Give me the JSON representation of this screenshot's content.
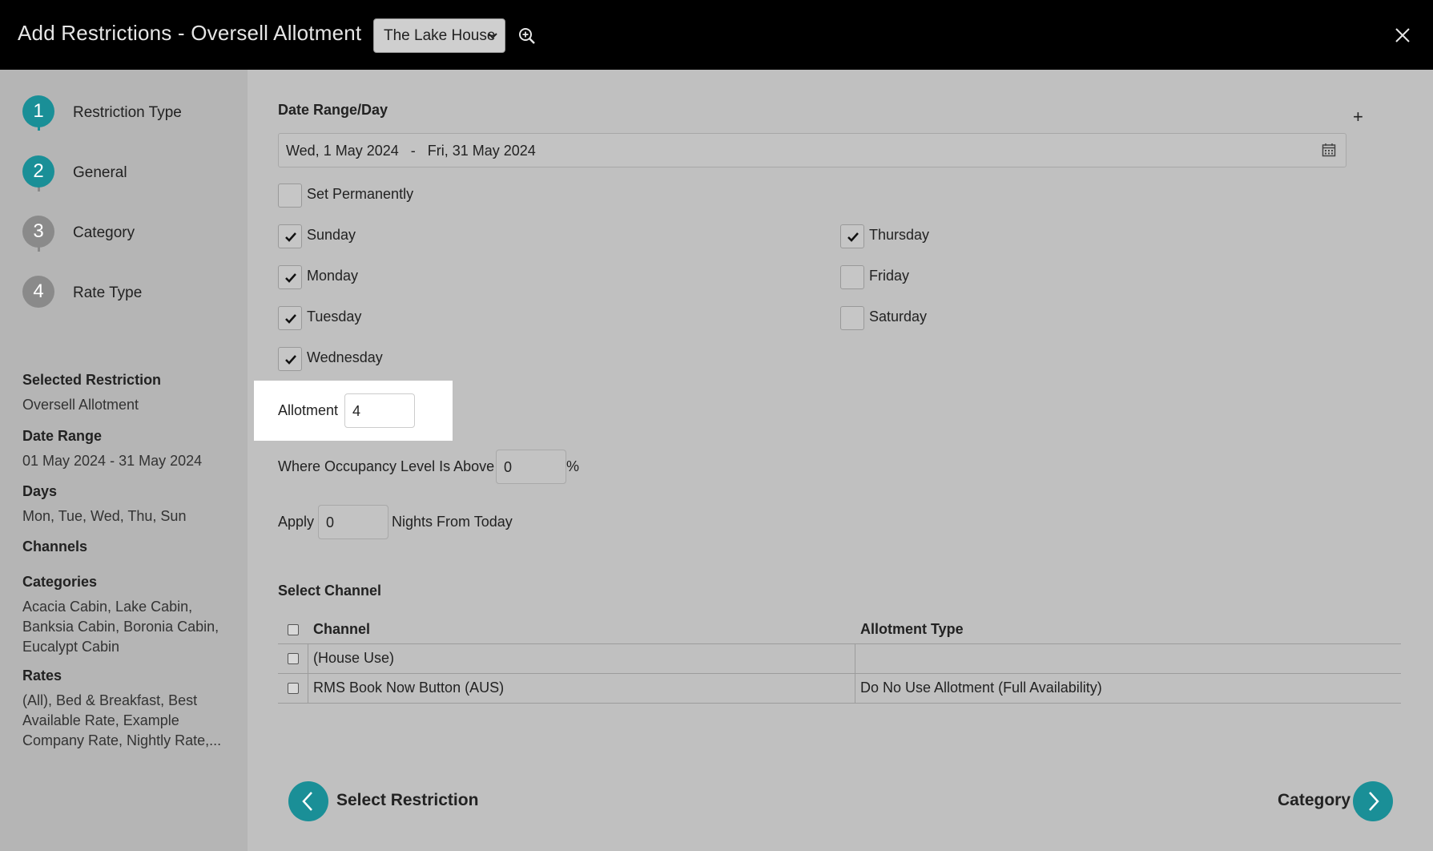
{
  "header": {
    "title": "Add Restrictions - Oversell Allotment",
    "property": "The Lake House"
  },
  "steps": [
    {
      "num": "1",
      "label": "Restriction Type",
      "state": "complete"
    },
    {
      "num": "2",
      "label": "General",
      "state": "current"
    },
    {
      "num": "3",
      "label": "Category",
      "state": "pending"
    },
    {
      "num": "4",
      "label": "Rate Type",
      "state": "pending"
    }
  ],
  "summary": {
    "selected_restriction_label": "Selected Restriction",
    "selected_restriction_value": "Oversell Allotment",
    "date_range_label": "Date Range",
    "date_range_value": "01 May 2024 - 31 May 2024",
    "days_label": "Days",
    "days_value": "Mon, Tue, Wed, Thu, Sun",
    "channels_label": "Channels",
    "categories_label": "Categories",
    "categories_value": "Acacia Cabin, Lake Cabin, Banksia Cabin, Boronia Cabin, Eucalypt Cabin",
    "rates_label": "Rates",
    "rates_value": "(All), Bed & Breakfast, Best Available Rate, Example Company Rate, Nightly Rate,..."
  },
  "form": {
    "date_section_title": "Date Range/Day",
    "date_range": "Wed, 1 May 2024   -   Fri, 31 May 2024",
    "set_permanently": {
      "label": "Set Permanently",
      "checked": false
    },
    "days": {
      "sunday": {
        "label": "Sunday",
        "checked": true
      },
      "monday": {
        "label": "Monday",
        "checked": true
      },
      "tuesday": {
        "label": "Tuesday",
        "checked": true
      },
      "wednesday": {
        "label": "Wednesday",
        "checked": true
      },
      "thursday": {
        "label": "Thursday",
        "checked": true
      },
      "friday": {
        "label": "Friday",
        "checked": false
      },
      "saturday": {
        "label": "Saturday",
        "checked": false
      }
    },
    "allotment_label": "Allotment",
    "allotment_value": "4",
    "occupancy_label": "Where Occupancy Level Is Above",
    "occupancy_value": "0",
    "occupancy_unit": "%",
    "apply_label": "Apply",
    "apply_value": "0",
    "apply_suffix": "Nights From Today"
  },
  "channels": {
    "title": "Select Channel",
    "col_channel": "Channel",
    "col_allotment_type": "Allotment Type",
    "rows": [
      {
        "channel": "(House Use)",
        "allotment_type": ""
      },
      {
        "channel": "RMS Book Now Button (AUS)",
        "allotment_type": "Do No Use Allotment (Full Availability)"
      }
    ]
  },
  "nav": {
    "back_label": "Select Restriction",
    "next_label": "Category"
  },
  "colors": {
    "accent": "#1a8f97",
    "header_bg": "#000000",
    "highlight": "#ffffff"
  }
}
